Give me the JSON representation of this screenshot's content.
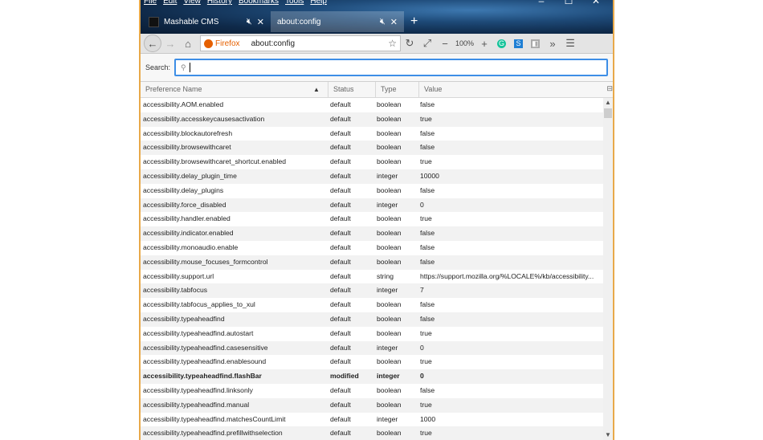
{
  "menu": [
    "File",
    "Edit",
    "View",
    "History",
    "Bookmarks",
    "Tools",
    "Help"
  ],
  "tabs": [
    {
      "title": "Mashable CMS"
    },
    {
      "title": "about:config"
    }
  ],
  "navbar": {
    "identity_label": "Firefox",
    "url": "about:config",
    "zoom": "100%"
  },
  "search": {
    "label": "Search:",
    "value": ""
  },
  "table": {
    "columns": [
      "Preference Name",
      "Status",
      "Type",
      "Value"
    ],
    "rows": [
      {
        "name": "accessibility.AOM.enabled",
        "status": "default",
        "type": "boolean",
        "value": "false"
      },
      {
        "name": "accessibility.accesskeycausesactivation",
        "status": "default",
        "type": "boolean",
        "value": "true"
      },
      {
        "name": "accessibility.blockautorefresh",
        "status": "default",
        "type": "boolean",
        "value": "false"
      },
      {
        "name": "accessibility.browsewithcaret",
        "status": "default",
        "type": "boolean",
        "value": "false"
      },
      {
        "name": "accessibility.browsewithcaret_shortcut.enabled",
        "status": "default",
        "type": "boolean",
        "value": "true"
      },
      {
        "name": "accessibility.delay_plugin_time",
        "status": "default",
        "type": "integer",
        "value": "10000"
      },
      {
        "name": "accessibility.delay_plugins",
        "status": "default",
        "type": "boolean",
        "value": "false"
      },
      {
        "name": "accessibility.force_disabled",
        "status": "default",
        "type": "integer",
        "value": "0"
      },
      {
        "name": "accessibility.handler.enabled",
        "status": "default",
        "type": "boolean",
        "value": "true"
      },
      {
        "name": "accessibility.indicator.enabled",
        "status": "default",
        "type": "boolean",
        "value": "false"
      },
      {
        "name": "accessibility.monoaudio.enable",
        "status": "default",
        "type": "boolean",
        "value": "false"
      },
      {
        "name": "accessibility.mouse_focuses_formcontrol",
        "status": "default",
        "type": "boolean",
        "value": "false"
      },
      {
        "name": "accessibility.support.url",
        "status": "default",
        "type": "string",
        "value": "https://support.mozilla.org/%LOCALE%/kb/accessibility..."
      },
      {
        "name": "accessibility.tabfocus",
        "status": "default",
        "type": "integer",
        "value": "7"
      },
      {
        "name": "accessibility.tabfocus_applies_to_xul",
        "status": "default",
        "type": "boolean",
        "value": "false"
      },
      {
        "name": "accessibility.typeaheadfind",
        "status": "default",
        "type": "boolean",
        "value": "false"
      },
      {
        "name": "accessibility.typeaheadfind.autostart",
        "status": "default",
        "type": "boolean",
        "value": "true"
      },
      {
        "name": "accessibility.typeaheadfind.casesensitive",
        "status": "default",
        "type": "integer",
        "value": "0"
      },
      {
        "name": "accessibility.typeaheadfind.enablesound",
        "status": "default",
        "type": "boolean",
        "value": "true"
      },
      {
        "name": "accessibility.typeaheadfind.flashBar",
        "status": "modified",
        "type": "integer",
        "value": "0"
      },
      {
        "name": "accessibility.typeaheadfind.linksonly",
        "status": "default",
        "type": "boolean",
        "value": "false"
      },
      {
        "name": "accessibility.typeaheadfind.manual",
        "status": "default",
        "type": "boolean",
        "value": "true"
      },
      {
        "name": "accessibility.typeaheadfind.matchesCountLimit",
        "status": "default",
        "type": "integer",
        "value": "1000"
      },
      {
        "name": "accessibility.typeaheadfind.prefillwithselection",
        "status": "default",
        "type": "boolean",
        "value": "true"
      }
    ]
  },
  "colors": {
    "window_border": "#e8a94a",
    "search_focus": "#3d8ee6",
    "firefox_orange": "#e66000"
  }
}
